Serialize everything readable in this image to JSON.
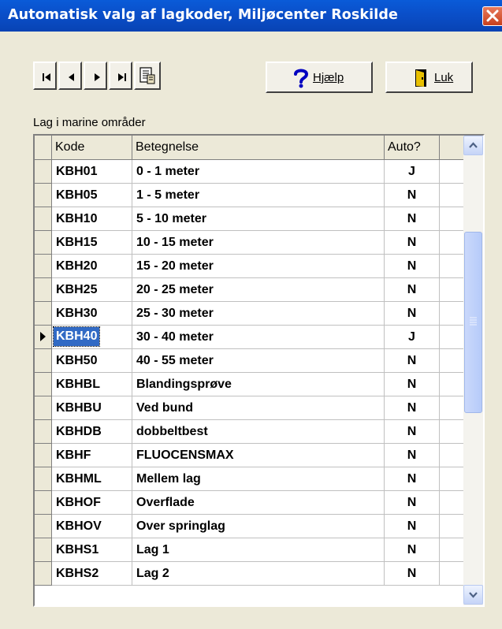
{
  "window": {
    "title": "Automatisk valg af lagkoder, Miljøcenter Roskilde"
  },
  "toolbar": {
    "nav": [
      {
        "name": "first-record-button",
        "icon": "first-record-icon"
      },
      {
        "name": "prev-record-button",
        "icon": "prev-record-icon"
      },
      {
        "name": "next-record-button",
        "icon": "next-record-icon"
      },
      {
        "name": "last-record-button",
        "icon": "last-record-icon"
      },
      {
        "name": "report-button",
        "icon": "report-icon"
      }
    ],
    "help_label": "Hjælp",
    "help_icon": "question-icon",
    "close_label": "Luk",
    "close_icon": "door-exit-icon"
  },
  "grid": {
    "label": "Lag i marine områder",
    "columns": [
      "Kode",
      "Betegnelse",
      "Auto?"
    ],
    "selected_index": 7,
    "rows": [
      {
        "kode": "KBH01",
        "betegnelse": "0 - 1 meter",
        "auto": "J"
      },
      {
        "kode": "KBH05",
        "betegnelse": "1 - 5 meter",
        "auto": "N"
      },
      {
        "kode": "KBH10",
        "betegnelse": "5 - 10 meter",
        "auto": "N"
      },
      {
        "kode": "KBH15",
        "betegnelse": "10 - 15 meter",
        "auto": "N"
      },
      {
        "kode": "KBH20",
        "betegnelse": "15 - 20 meter",
        "auto": "N"
      },
      {
        "kode": "KBH25",
        "betegnelse": "20 - 25 meter",
        "auto": "N"
      },
      {
        "kode": "KBH30",
        "betegnelse": "25 - 30 meter",
        "auto": "N"
      },
      {
        "kode": "KBH40",
        "betegnelse": "30 - 40 meter",
        "auto": "J"
      },
      {
        "kode": "KBH50",
        "betegnelse": "40 - 55 meter",
        "auto": "N"
      },
      {
        "kode": "KBHBL",
        "betegnelse": "Blandingsprøve",
        "auto": "N"
      },
      {
        "kode": "KBHBU",
        "betegnelse": "Ved bund",
        "auto": "N"
      },
      {
        "kode": "KBHDB",
        "betegnelse": "dobbeltbest",
        "auto": "N"
      },
      {
        "kode": "KBHF",
        "betegnelse": "FLUOCENSMAX",
        "auto": "N"
      },
      {
        "kode": "KBHML",
        "betegnelse": "Mellem lag",
        "auto": "N"
      },
      {
        "kode": "KBHOF",
        "betegnelse": "Overflade",
        "auto": "N"
      },
      {
        "kode": "KBHOV",
        "betegnelse": "Over springlag",
        "auto": "N"
      },
      {
        "kode": "KBHS1",
        "betegnelse": "Lag 1",
        "auto": "N"
      },
      {
        "kode": "KBHS2",
        "betegnelse": "Lag 2",
        "auto": "N"
      }
    ]
  },
  "colors": {
    "titlebar": "#0a4fc9",
    "selection": "#316ac5",
    "face": "#ece9d8"
  }
}
